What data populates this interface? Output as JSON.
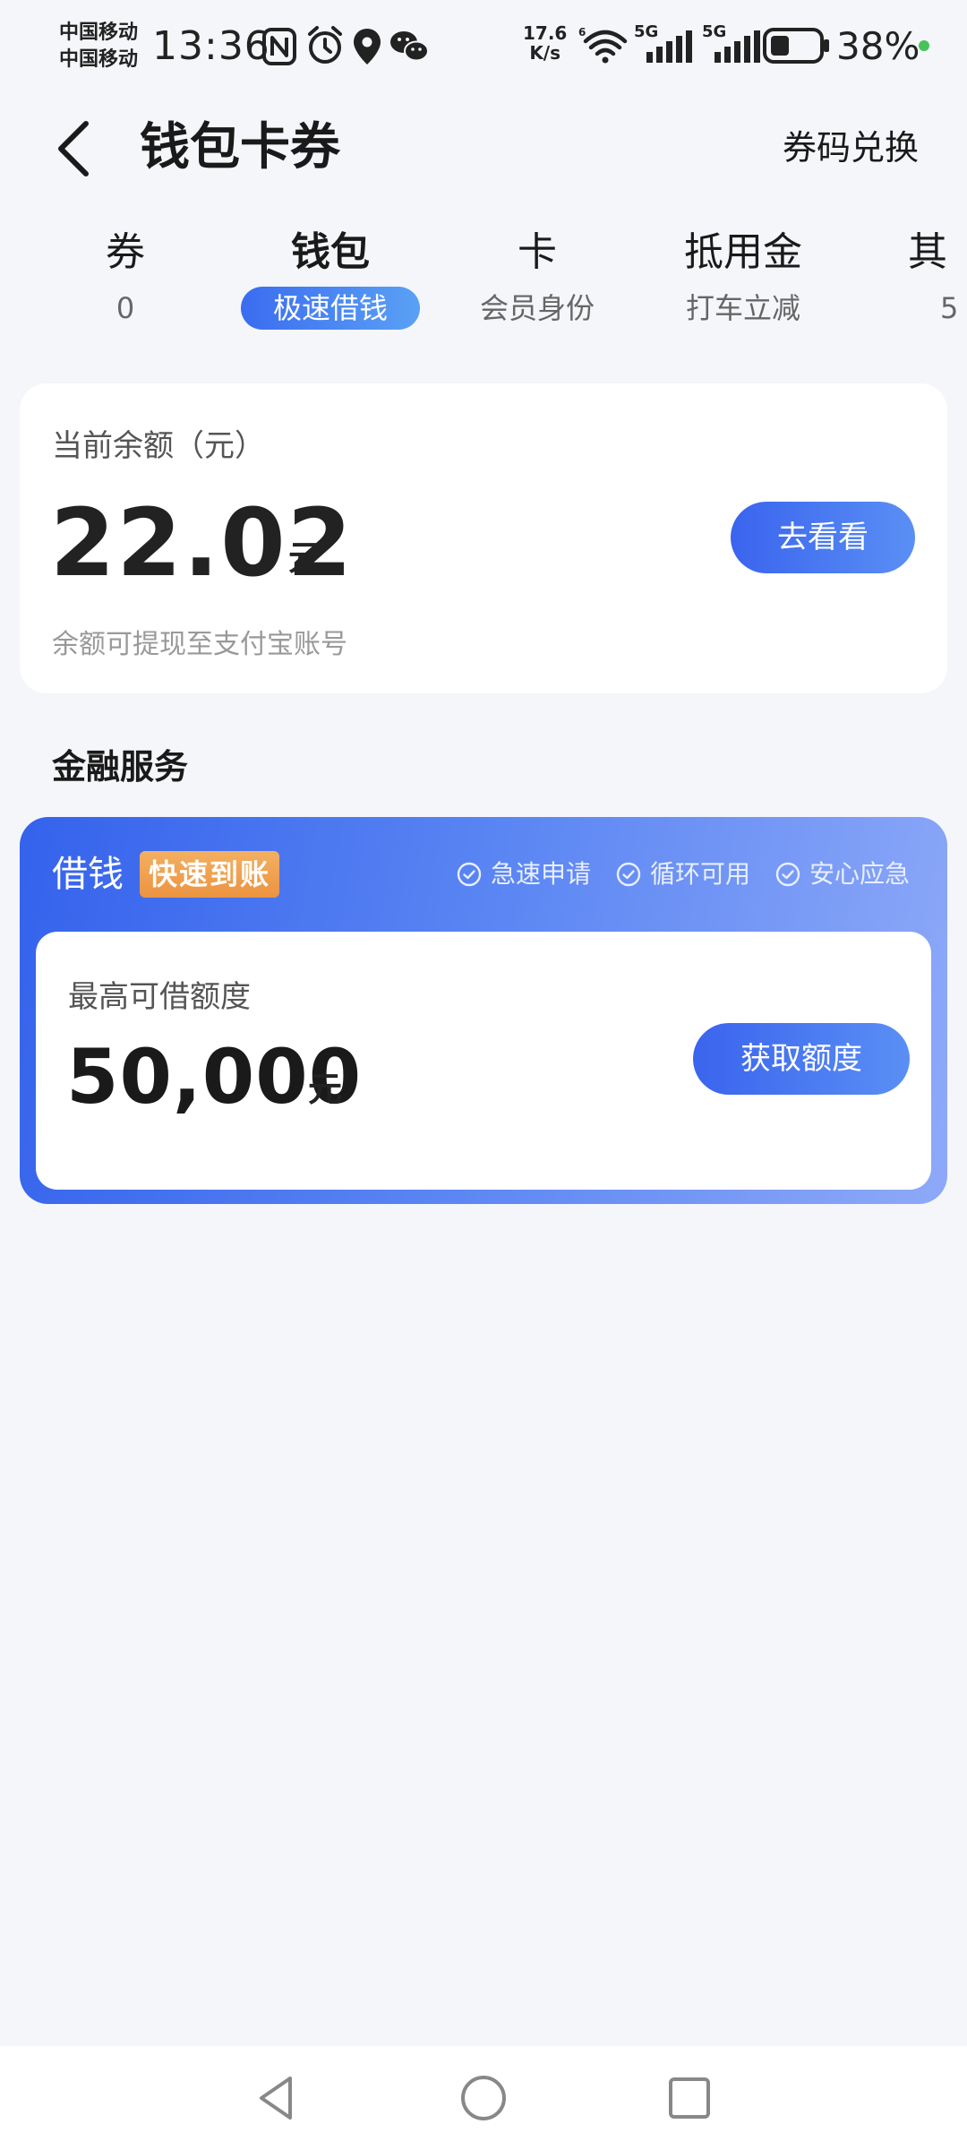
{
  "status_bar": {
    "carrier_1": "中国移动",
    "carrier_2": "中国移动",
    "time": "13:36",
    "net_speed_value": "17.6",
    "net_speed_unit": "K/s",
    "signal_1_label": "5G",
    "signal_2_label": "5G",
    "battery": "38%",
    "icons": [
      "nfc-icon",
      "alarm-icon",
      "location-icon",
      "wechat-icon",
      "wifi-icon",
      "signal-icon",
      "battery-icon"
    ]
  },
  "header": {
    "title": "钱包卡券",
    "redeem_label": "券码兑换"
  },
  "tabs": [
    {
      "label": "券",
      "sub": "0"
    },
    {
      "label": "钱包",
      "sub": "极速借钱"
    },
    {
      "label": "卡",
      "sub": "会员身份"
    },
    {
      "label": "抵用金",
      "sub": "打车立减"
    },
    {
      "label": "其",
      "sub": "5"
    }
  ],
  "balance": {
    "label": "当前余额（元）",
    "value": "22.02",
    "unit": "元",
    "note": "余额可提现至支付宝账号",
    "button_label": "去看看"
  },
  "finance": {
    "section_title": "金融服务",
    "loan_title": "借钱",
    "badge": "快速到账",
    "features": [
      "急速申请",
      "循环可用",
      "安心应急"
    ],
    "limit_label": "最高可借额度",
    "limit_value": "50,000",
    "limit_unit": "元",
    "button_label": "获取额度"
  },
  "colors": {
    "accent": "#3a64ee",
    "badge": "#ec9340",
    "background": "#f4f6f9"
  }
}
